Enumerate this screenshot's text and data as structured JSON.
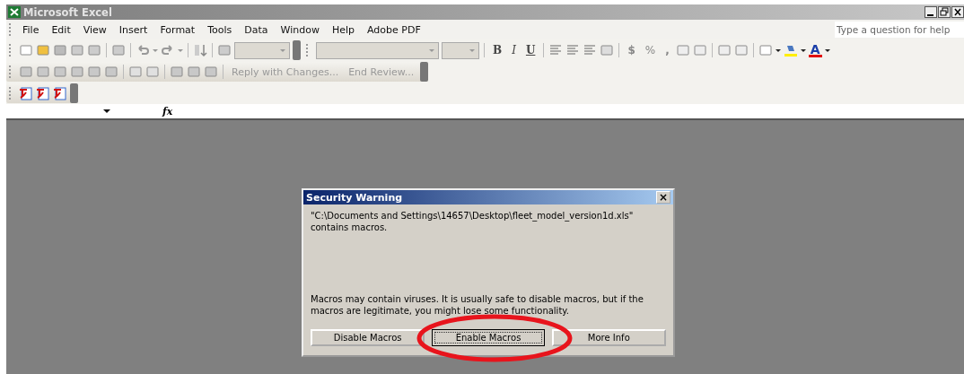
{
  "window": {
    "title": "Microsoft Excel"
  },
  "menu": [
    {
      "label": "File"
    },
    {
      "label": "Edit"
    },
    {
      "label": "View"
    },
    {
      "label": "Insert"
    },
    {
      "label": "Format"
    },
    {
      "label": "Tools"
    },
    {
      "label": "Data"
    },
    {
      "label": "Window"
    },
    {
      "label": "Help"
    },
    {
      "label": "Adobe PDF"
    }
  ],
  "help_box": {
    "placeholder": "Type a question for help"
  },
  "format_toolbar": {
    "bold": "B",
    "italic": "I",
    "underline": "U",
    "currency": "$",
    "percent": "%",
    "comma": ",",
    "font_color": "A"
  },
  "reviewing_toolbar": {
    "reply": "Reply with Changes...",
    "end_review": "End Review..."
  },
  "formula_bar": {
    "fx": "fx"
  },
  "dialog": {
    "title": "Security Warning",
    "close": "×",
    "message": "\"C:\\Documents and Settings\\14657\\Desktop\\fleet_model_version1d.xls\" contains macros.",
    "warning": "Macros may contain viruses. It is usually safe to disable macros, but if the macros are legitimate, you might lose some functionality.",
    "buttons": [
      {
        "label": "Disable Macros",
        "selected": false
      },
      {
        "label": "Enable Macros",
        "selected": true
      },
      {
        "label": "More Info",
        "selected": false
      }
    ]
  }
}
